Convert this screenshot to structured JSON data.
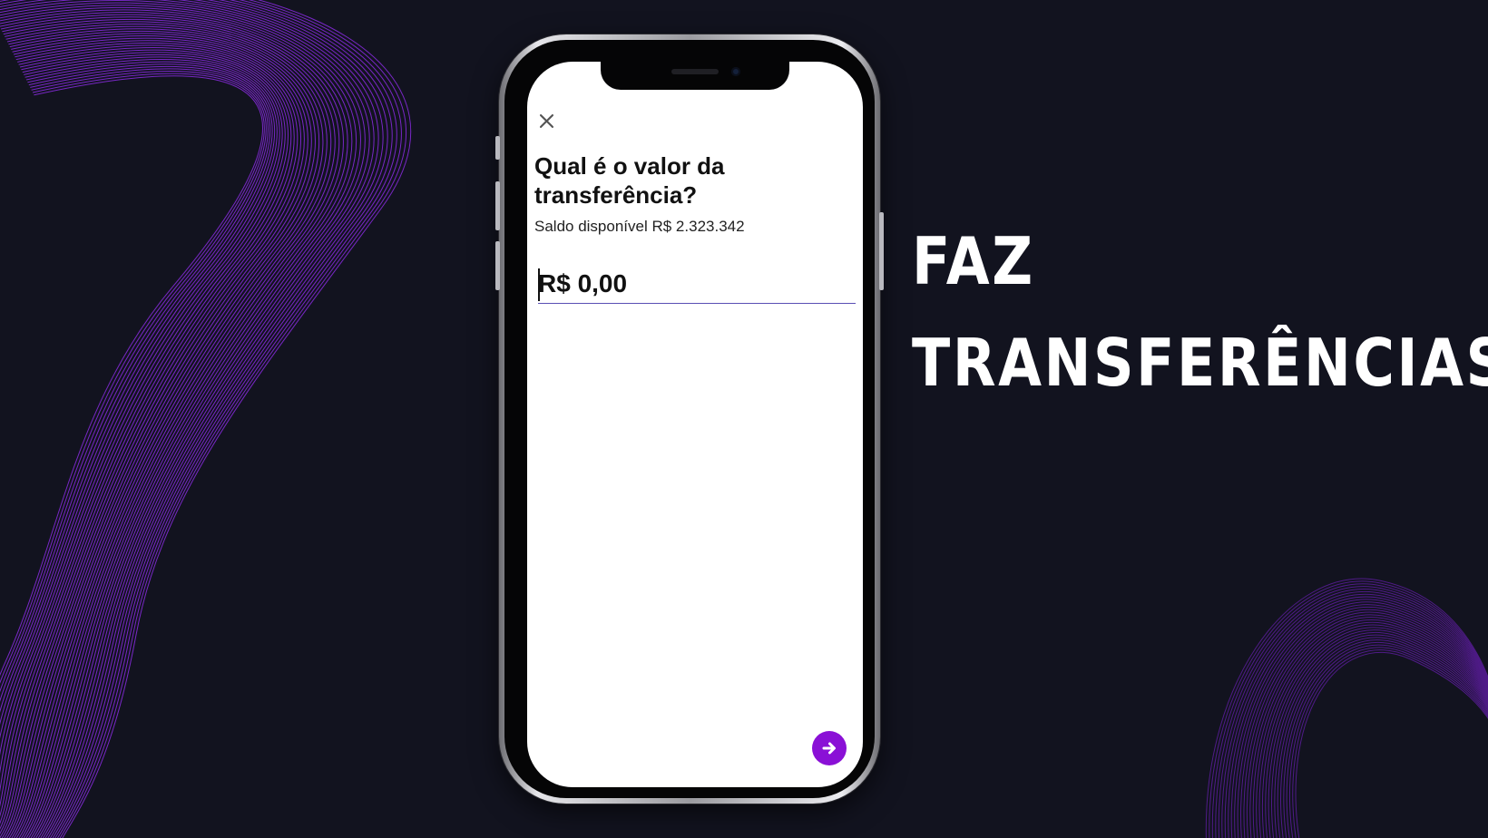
{
  "colors": {
    "background": "#12131f",
    "wave_accent": "#8a2be2",
    "action_button": "#8a10d6",
    "input_underline": "#5a4fb4"
  },
  "headline": {
    "line1": "FAZ",
    "line2": "TRANSFERÊNCIAS"
  },
  "app": {
    "close_icon": "close-icon",
    "title": "Qual é o valor da\ntransferência?",
    "balance_text": "Saldo disponível R$ 2.323.342",
    "amount_value": "R$ 0,00",
    "next_icon": "arrow-right-icon"
  }
}
